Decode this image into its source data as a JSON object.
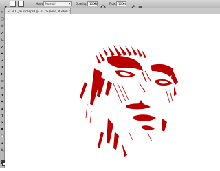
{
  "options_bar": {
    "mode_label": "Mode:",
    "mode_value": "Normal",
    "opacity_label": "Opacity:",
    "opacity_value": "100%",
    "flow_label": "Flow:",
    "flow_value": "100%"
  },
  "document": {
    "tab_title": "VOL_musical.psd @ 30.7% (Rojo, RGB/8) *"
  },
  "colors": {
    "foreground": "#c40000",
    "background": "#ffffff",
    "ink": "#b80000"
  },
  "tools": [
    "move-tool-icon",
    "marquee-tool-icon",
    "lasso-tool-icon",
    "magic-wand-icon",
    "crop-tool-icon",
    "eyedropper-icon",
    "healing-brush-icon",
    "brush-tool-icon",
    "clone-stamp-icon",
    "history-brush-icon",
    "eraser-icon",
    "gradient-icon",
    "blur-icon",
    "dodge-icon",
    "pen-icon",
    "type-tool-icon",
    "path-select-icon",
    "shape-tool-icon",
    "notes-icon",
    "hand-tool-icon",
    "zoom-tool-icon"
  ]
}
